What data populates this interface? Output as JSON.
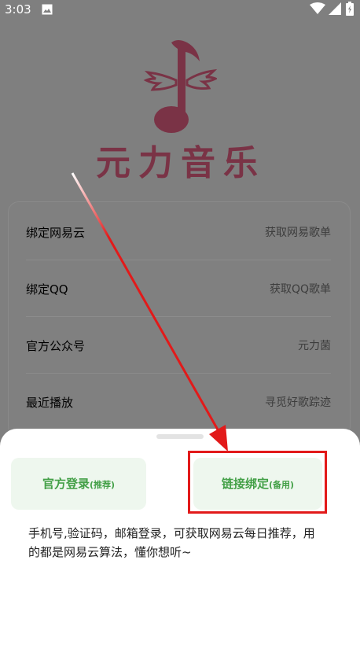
{
  "status_bar": {
    "time": "3:03",
    "icons": [
      "image-icon",
      "wifi-icon",
      "signal-icon",
      "battery-icon"
    ]
  },
  "logo": {
    "icon": "winged-music-note-icon",
    "text": "元力音乐",
    "color": "#b94a6b"
  },
  "menu": {
    "items": [
      {
        "label": "绑定网易云",
        "value": "获取网易歌单"
      },
      {
        "label": "绑定QQ",
        "value": "获取QQ歌单"
      },
      {
        "label": "官方公众号",
        "value": "元力菌"
      },
      {
        "label": "最近播放",
        "value": "寻觅好歌踪迹"
      }
    ]
  },
  "sheet": {
    "official_login": {
      "label": "官方登录",
      "sub": "(推荐)"
    },
    "link_bind": {
      "label": "链接绑定",
      "sub": "(备用)"
    },
    "description": "手机号,验证码，邮箱登录，可获取网易云每日推荐，用的都是网易云算法，懂你想听~"
  },
  "colors": {
    "accent_green": "#43a047",
    "button_bg": "#eef7ee",
    "highlight_red": "#e21a1a"
  }
}
